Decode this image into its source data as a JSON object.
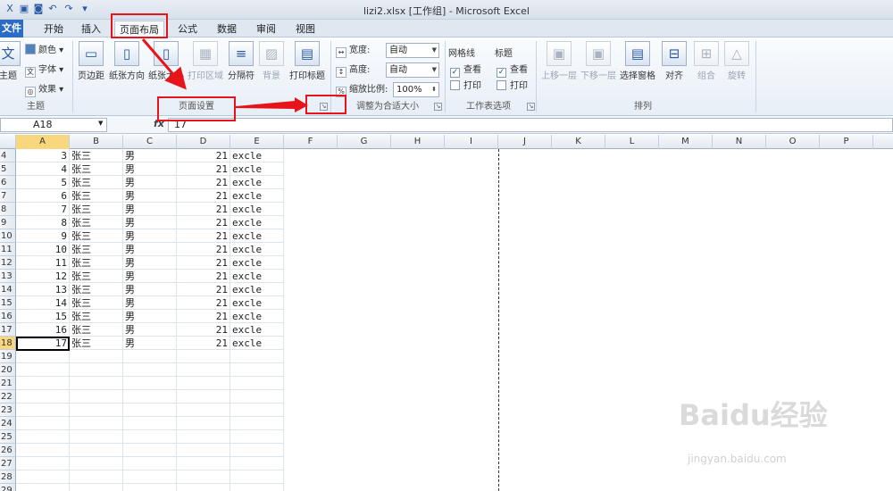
{
  "window": {
    "title": "lizi2.xlsx  [工作组] - Microsoft Excel"
  },
  "tabs": [
    "文件",
    "开始",
    "插入",
    "页面布局",
    "公式",
    "数据",
    "审阅",
    "视图"
  ],
  "ribbon": {
    "theme_label": "主题",
    "color_label": "颜色",
    "font_label": "字体",
    "effect_label": "效果",
    "margin_label": "页边距",
    "orientation_label": "纸张方向",
    "size_label": "纸张大小",
    "print_area_label": "打印区域",
    "breaks_label": "分隔符",
    "background_label": "背景",
    "print_titles_label": "打印标题",
    "width_label": "宽度:",
    "width_value": "自动",
    "height_label": "高度:",
    "height_value": "自动",
    "scale_label": "缩放比例:",
    "scale_value": "100%",
    "gridlines_label": "网格线",
    "headings_label": "标题",
    "view_label": "查看",
    "print_label": "打印",
    "bring_forward_label": "上移一层",
    "send_backward_label": "下移一层",
    "selection_pane_label": "选择窗格",
    "align_label": "对齐",
    "group_label": "组合",
    "rotate_label": "旋转",
    "group_theme": "主题",
    "group_page_setup": "页面设置",
    "group_scale_fit": "调整为合适大小",
    "group_sheet_options": "工作表选项",
    "group_arrange": "排列"
  },
  "formula_bar": {
    "name_box": "A18",
    "fx": "fx",
    "value": "17"
  },
  "columns": [
    "A",
    "B",
    "C",
    "D",
    "E",
    "F",
    "G",
    "H",
    "I",
    "J",
    "K",
    "L",
    "M",
    "N",
    "O",
    "P"
  ],
  "rows": [
    {
      "num": "4",
      "a": "3",
      "b": "张三",
      "c": "男",
      "d": "21",
      "e": "excle"
    },
    {
      "num": "5",
      "a": "4",
      "b": "张三",
      "c": "男",
      "d": "21",
      "e": "excle"
    },
    {
      "num": "6",
      "a": "5",
      "b": "张三",
      "c": "男",
      "d": "21",
      "e": "excle"
    },
    {
      "num": "7",
      "a": "6",
      "b": "张三",
      "c": "男",
      "d": "21",
      "e": "excle"
    },
    {
      "num": "8",
      "a": "7",
      "b": "张三",
      "c": "男",
      "d": "21",
      "e": "excle"
    },
    {
      "num": "9",
      "a": "8",
      "b": "张三",
      "c": "男",
      "d": "21",
      "e": "excle"
    },
    {
      "num": "10",
      "a": "9",
      "b": "张三",
      "c": "男",
      "d": "21",
      "e": "excle"
    },
    {
      "num": "11",
      "a": "10",
      "b": "张三",
      "c": "男",
      "d": "21",
      "e": "excle"
    },
    {
      "num": "12",
      "a": "11",
      "b": "张三",
      "c": "男",
      "d": "21",
      "e": "excle"
    },
    {
      "num": "13",
      "a": "12",
      "b": "张三",
      "c": "男",
      "d": "21",
      "e": "excle"
    },
    {
      "num": "14",
      "a": "13",
      "b": "张三",
      "c": "男",
      "d": "21",
      "e": "excle"
    },
    {
      "num": "15",
      "a": "14",
      "b": "张三",
      "c": "男",
      "d": "21",
      "e": "excle"
    },
    {
      "num": "16",
      "a": "15",
      "b": "张三",
      "c": "男",
      "d": "21",
      "e": "excle"
    },
    {
      "num": "17",
      "a": "16",
      "b": "张三",
      "c": "男",
      "d": "21",
      "e": "excle"
    },
    {
      "num": "18",
      "a": "17",
      "b": "张三",
      "c": "男",
      "d": "21",
      "e": "excle"
    },
    {
      "num": "19"
    },
    {
      "num": "20"
    },
    {
      "num": "21"
    },
    {
      "num": "22"
    },
    {
      "num": "23"
    },
    {
      "num": "24"
    },
    {
      "num": "25"
    },
    {
      "num": "26"
    },
    {
      "num": "27"
    },
    {
      "num": "28"
    },
    {
      "num": "29"
    }
  ],
  "watermark": {
    "brand": "Baidu经验",
    "url": "jingyan.baidu.com"
  },
  "colors": {
    "annotation": "#e8141b",
    "file_tab": "#2b6cc4",
    "selected_header": "#f9d77e"
  }
}
